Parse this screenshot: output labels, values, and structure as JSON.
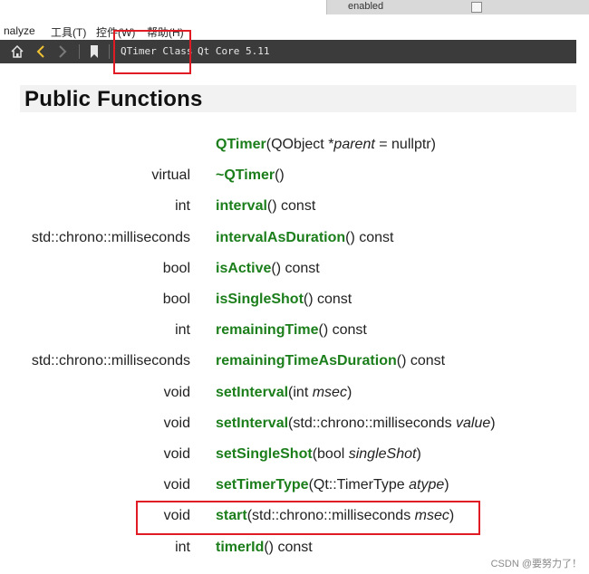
{
  "background": {
    "enabled_text": "enabled"
  },
  "menubar": {
    "items": [
      "nalyze",
      "工具(T)",
      "控件(W)",
      "帮助(H)"
    ]
  },
  "toolbar": {
    "breadcrumb_class": "QTimer Class",
    "breadcrumb_module": "Qt Core 5.11"
  },
  "section": {
    "title": "Public Functions"
  },
  "functions": [
    {
      "ret": "",
      "name": "QTimer",
      "pre": "(QObject *",
      "arg": "parent",
      "post": " = nullptr)"
    },
    {
      "ret": "virtual",
      "name": "~QTimer",
      "pre": "()",
      "arg": "",
      "post": ""
    },
    {
      "ret": "int",
      "name": "interval",
      "pre": "() const",
      "arg": "",
      "post": ""
    },
    {
      "ret": "std::chrono::milliseconds",
      "name": "intervalAsDuration",
      "pre": "() const",
      "arg": "",
      "post": ""
    },
    {
      "ret": "bool",
      "name": "isActive",
      "pre": "() const",
      "arg": "",
      "post": ""
    },
    {
      "ret": "bool",
      "name": "isSingleShot",
      "pre": "() const",
      "arg": "",
      "post": ""
    },
    {
      "ret": "int",
      "name": "remainingTime",
      "pre": "() const",
      "arg": "",
      "post": ""
    },
    {
      "ret": "std::chrono::milliseconds",
      "name": "remainingTimeAsDuration",
      "pre": "() const",
      "arg": "",
      "post": ""
    },
    {
      "ret": "void",
      "name": "setInterval",
      "pre": "(int ",
      "arg": "msec",
      "post": ")"
    },
    {
      "ret": "void",
      "name": "setInterval",
      "pre": "(std::chrono::milliseconds ",
      "arg": "value",
      "post": ")"
    },
    {
      "ret": "void",
      "name": "setSingleShot",
      "pre": "(bool ",
      "arg": "singleShot",
      "post": ")"
    },
    {
      "ret": "void",
      "name": "setTimerType",
      "pre": "(Qt::TimerType ",
      "arg": "atype",
      "post": ")"
    },
    {
      "ret": "void",
      "name": "start",
      "pre": "(std::chrono::milliseconds ",
      "arg": "msec",
      "post": ")"
    },
    {
      "ret": "int",
      "name": "timerId",
      "pre": "() const",
      "arg": "",
      "post": ""
    }
  ],
  "watermark": "CSDN @要努力了！",
  "colors": {
    "function_name": "#1b7e1b",
    "highlight_box": "#e01b24",
    "toolbar_bg": "#3b3b3b"
  }
}
